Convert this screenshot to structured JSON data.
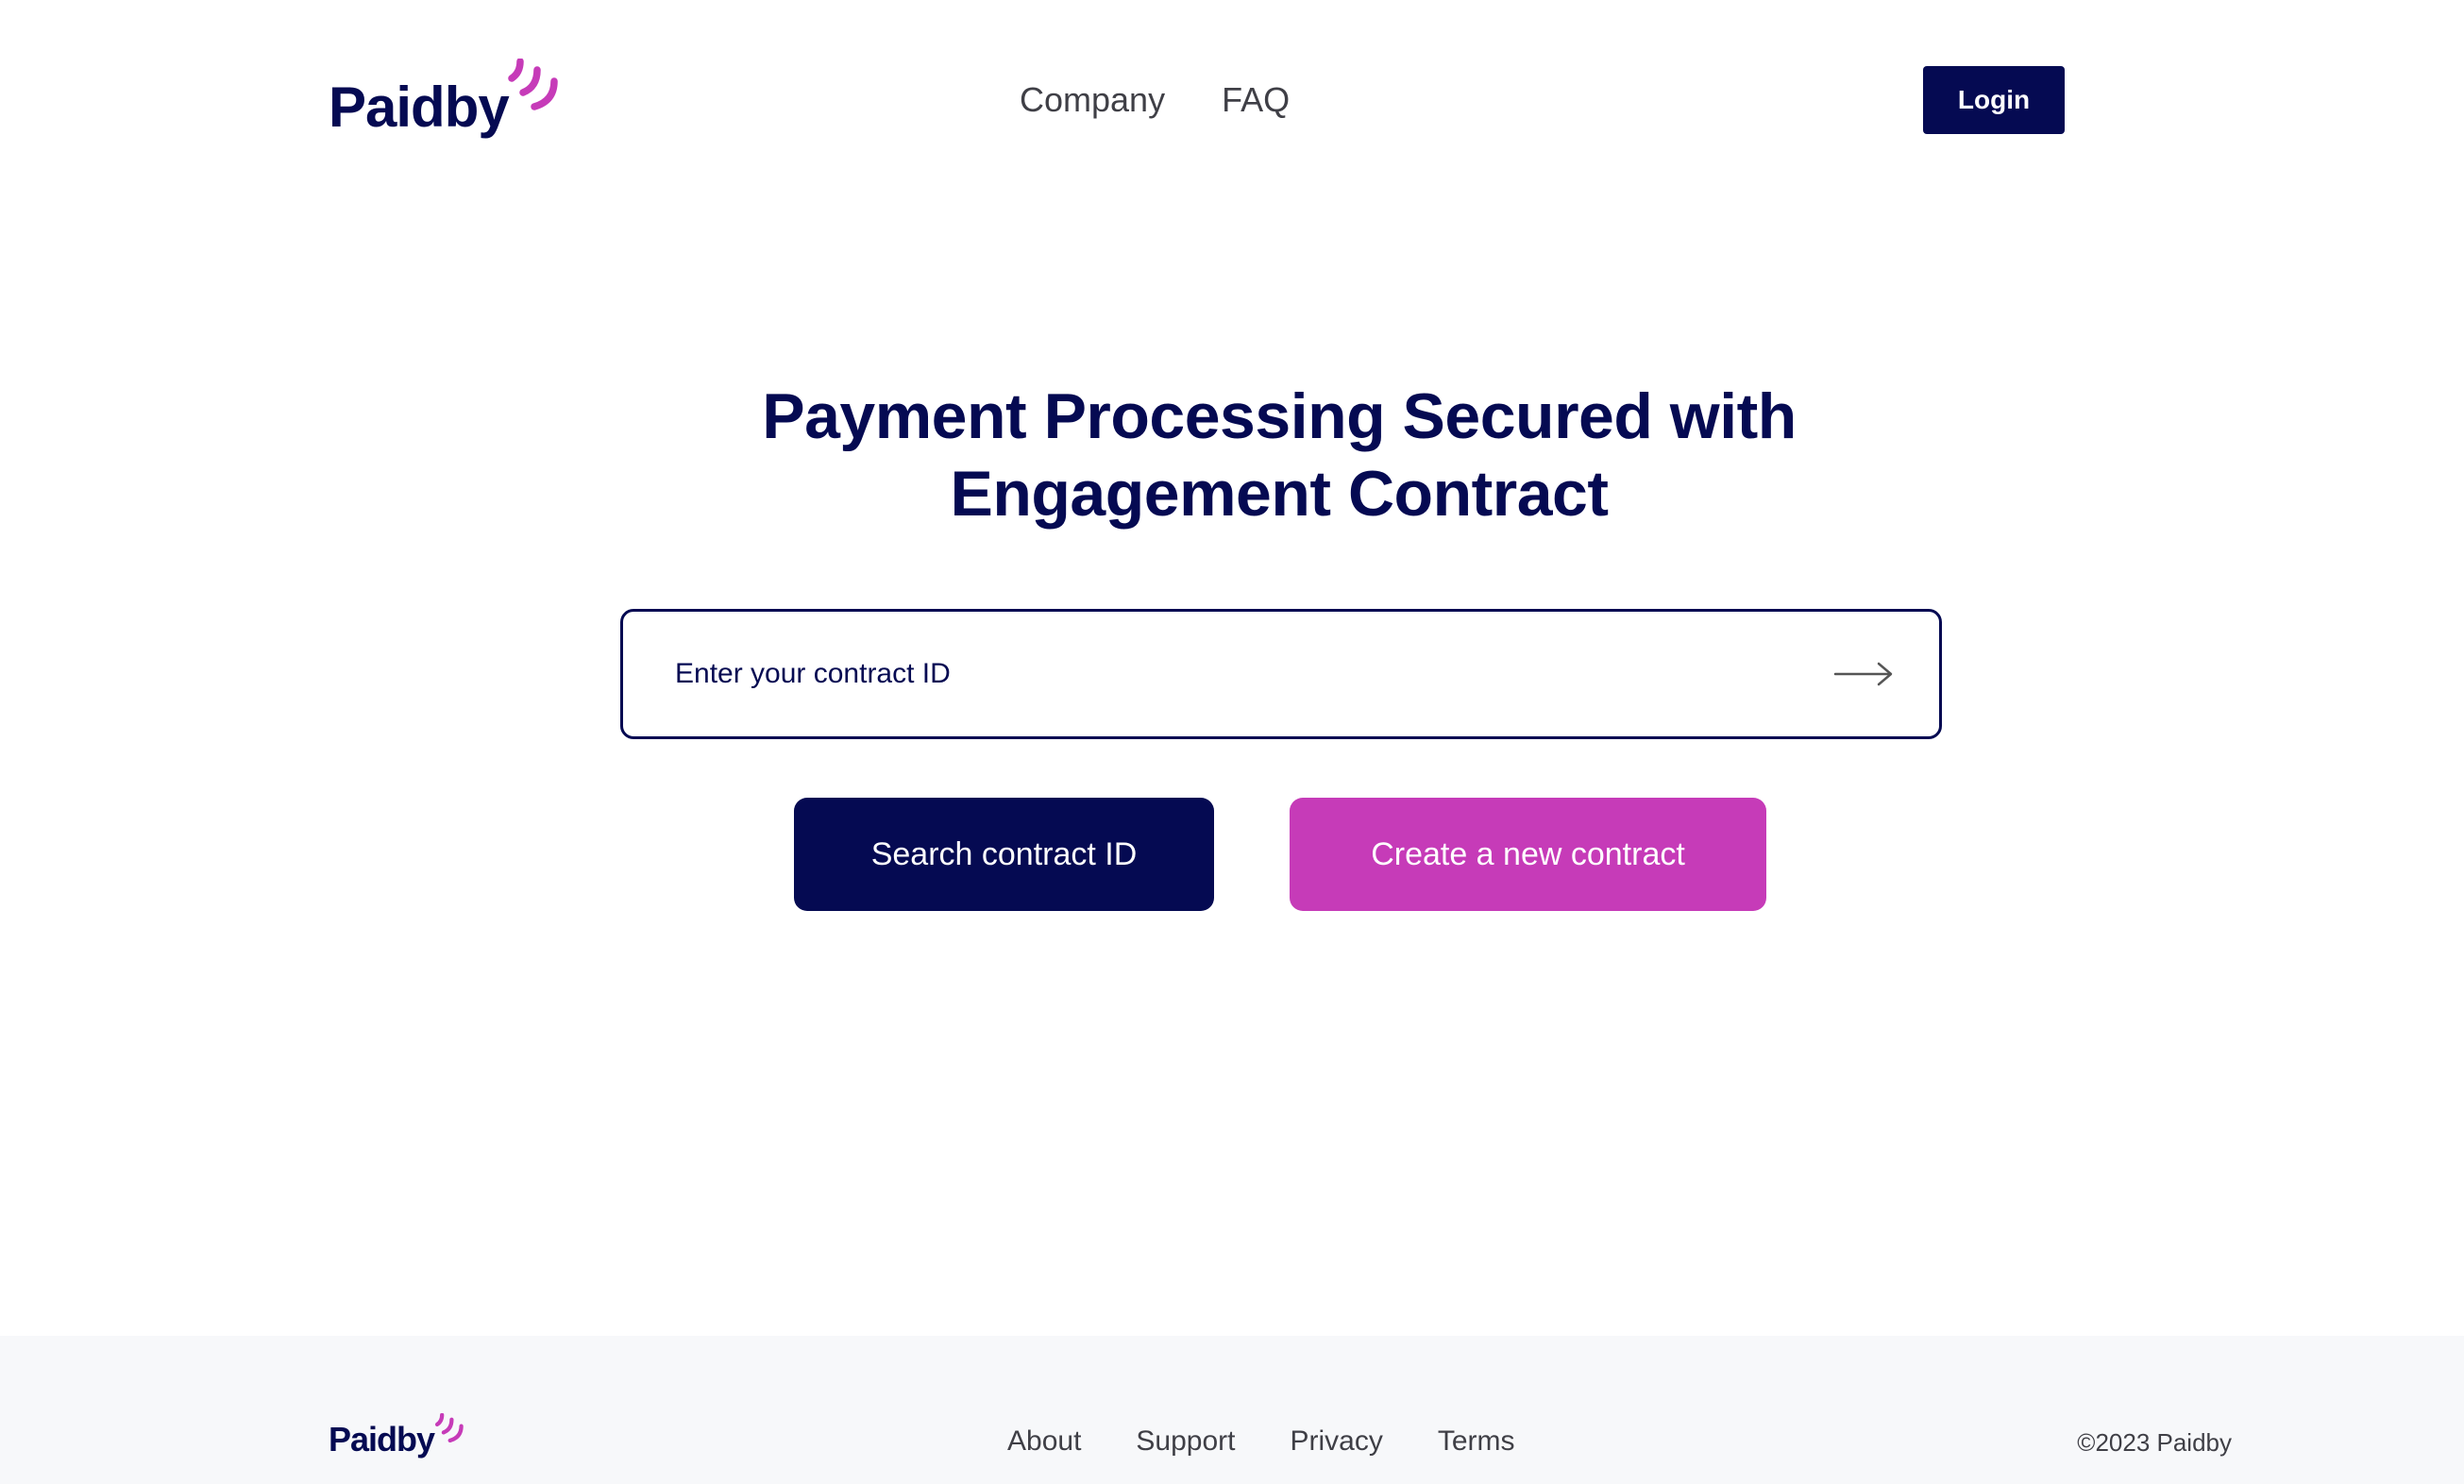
{
  "header": {
    "brand": "Paidby",
    "nav": [
      {
        "label": "Company"
      },
      {
        "label": "FAQ"
      }
    ],
    "login_label": "Login"
  },
  "hero": {
    "title_line1": "Payment Processing Secured with",
    "title_line2": "Engagement Contract",
    "input_placeholder": "Enter your contract ID",
    "search_label": "Search contract ID",
    "create_label": "Create a new contract"
  },
  "footer": {
    "brand": "Paidby",
    "links": [
      {
        "label": "About"
      },
      {
        "label": "Support"
      },
      {
        "label": "Privacy"
      },
      {
        "label": "Terms"
      }
    ],
    "copyright": "©2023 Paidby"
  },
  "colors": {
    "navy": "#050a52",
    "magenta": "#c63bb8",
    "footer_bg": "#f7f8fa",
    "nav_text": "#3f3f46"
  },
  "icons": {
    "logo_mark": "signal-waves-icon",
    "submit": "arrow-right-icon"
  }
}
